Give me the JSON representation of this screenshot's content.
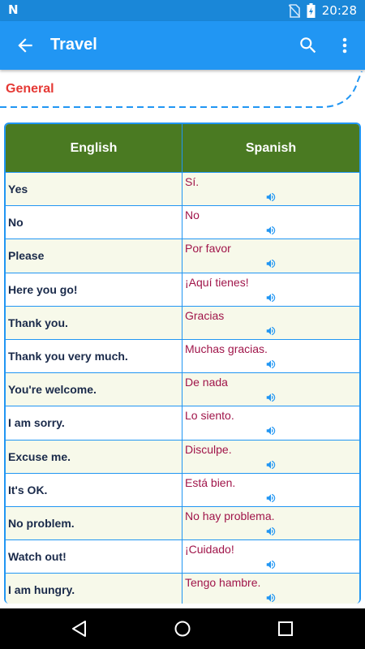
{
  "status_bar": {
    "time": "20:28",
    "left_icon": "n-logo",
    "icons": [
      "no-sim-icon",
      "battery-charging-icon"
    ]
  },
  "app_bar": {
    "title": "Travel",
    "back_icon": "arrow-back-icon",
    "search_icon": "search-icon",
    "more_icon": "more-vert-icon"
  },
  "section": {
    "label": "General"
  },
  "table": {
    "headers": {
      "english": "English",
      "spanish": "Spanish"
    },
    "rows": [
      {
        "english": "Yes",
        "spanish": "Sí."
      },
      {
        "english": "No",
        "spanish": "No"
      },
      {
        "english": "Please",
        "spanish": "Por favor"
      },
      {
        "english": "Here you go!",
        "spanish": "¡Aquí tienes!"
      },
      {
        "english": "Thank you.",
        "spanish": "Gracias"
      },
      {
        "english": "Thank you very much.",
        "spanish": "Muchas gracias."
      },
      {
        "english": "You're welcome.",
        "spanish": "De nada"
      },
      {
        "english": "I am sorry.",
        "spanish": "Lo siento."
      },
      {
        "english": "Excuse me.",
        "spanish": "Disculpe."
      },
      {
        "english": "It's OK.",
        "spanish": "Está bien."
      },
      {
        "english": "No problem.",
        "spanish": "No hay problema."
      },
      {
        "english": "Watch out!",
        "spanish": "¡Cuidado!"
      },
      {
        "english": "I am hungry.",
        "spanish": "Tengo hambre."
      }
    ]
  },
  "colors": {
    "status_bar": "#1a87d8",
    "app_bar": "#2196f3",
    "header_bg": "#4a7a22",
    "section_label": "#e53935",
    "spanish_text": "#a0154a",
    "speaker": "#2196f3"
  }
}
